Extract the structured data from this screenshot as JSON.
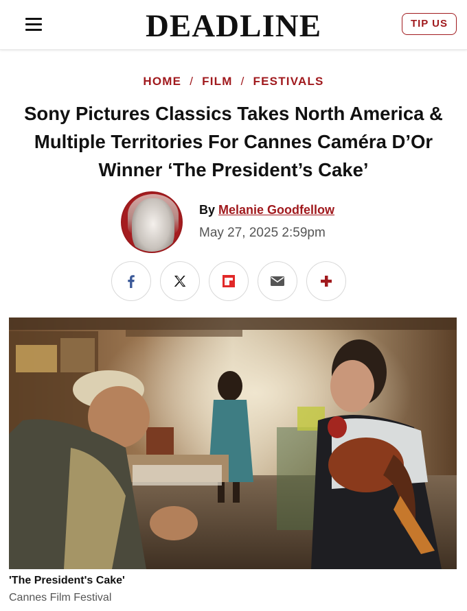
{
  "header": {
    "logo": "DEADLINE",
    "tip_label": "TIP US"
  },
  "breadcrumb": {
    "items": [
      "HOME",
      "FILM",
      "FESTIVALS"
    ],
    "separator": "/"
  },
  "article": {
    "title": "Sony Pictures Classics Takes North America & Multiple Territories For Cannes Caméra D’Or Winner ‘The President’s Cake’",
    "byline_prefix": "By",
    "author": "Melanie Goodfellow",
    "date": "May 27, 2025 2:59pm"
  },
  "share": {
    "buttons": [
      {
        "name": "facebook",
        "icon": "facebook-icon"
      },
      {
        "name": "x",
        "icon": "x-icon"
      },
      {
        "name": "flipboard",
        "icon": "flipboard-icon"
      },
      {
        "name": "email",
        "icon": "email-icon"
      },
      {
        "name": "more",
        "icon": "plus-icon"
      }
    ]
  },
  "image": {
    "caption_title": "'The President's Cake'",
    "caption_credit": "Cannes Film Festival"
  },
  "colors": {
    "accent": "#a0191d",
    "facebook": "#3b5998",
    "flipboard": "#e12828"
  }
}
